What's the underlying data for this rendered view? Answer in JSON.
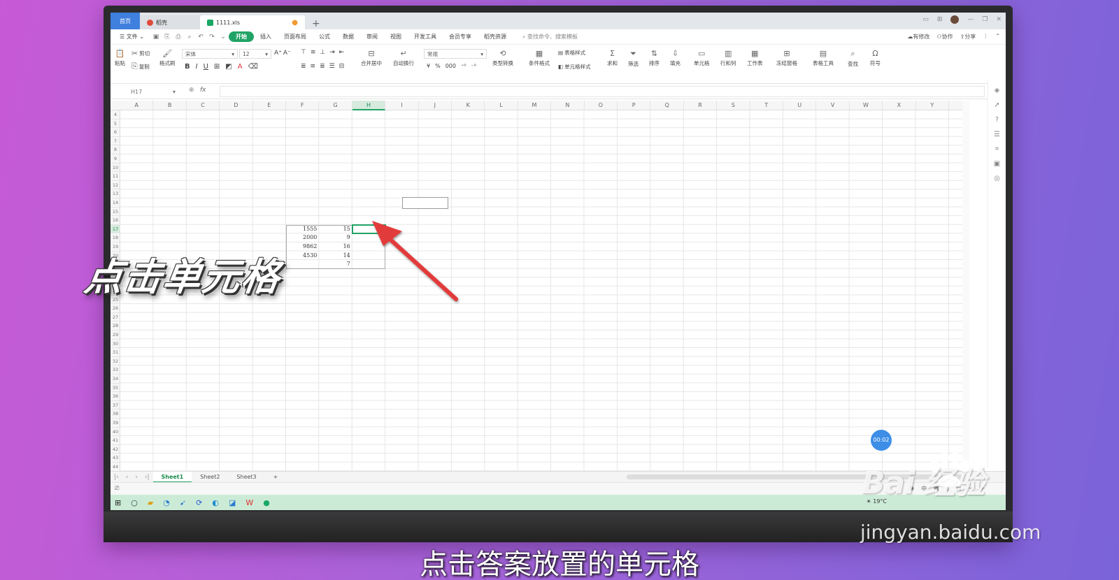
{
  "tabs": {
    "home": "首页",
    "shell": "稻壳",
    "file": "1111.xls",
    "modified_mark": "●",
    "add": "+"
  },
  "menu": {
    "file": "文件",
    "items": [
      "开始",
      "插入",
      "页面布局",
      "公式",
      "数据",
      "审阅",
      "视图",
      "开发工具",
      "会员专享",
      "稻壳资源"
    ],
    "active_index": 0,
    "search": "查找命令、搜索模板",
    "right": [
      "有修改",
      "协作",
      "分享"
    ]
  },
  "ribbon": {
    "clipboard": {
      "paste": "粘贴",
      "cut": "剪切",
      "copy": "复制",
      "format_painter": "格式刷"
    },
    "font": "宋体",
    "font_size": "12",
    "bold": "B",
    "italic": "I",
    "underline": "U",
    "merge": "合并居中",
    "wrap": "自动换行",
    "number_format": "常规",
    "currency": "¥",
    "percent": "%",
    "thousands": "000",
    "type_convert": "类型转换",
    "cond_format": "条件格式",
    "table_style": "表格样式",
    "cell_style": "单元格样式",
    "sum": "求和",
    "filter": "筛选",
    "sort": "排序",
    "fill": "填充",
    "cells": "单元格",
    "rows_cols": "行和列",
    "worksheet": "工作表",
    "freeze": "冻结窗格",
    "table_tools": "表格工具",
    "find": "查找",
    "symbol": "符号"
  },
  "formula_bar": {
    "name_box": "H17",
    "fx": "fx",
    "value": ""
  },
  "columns": [
    "A",
    "B",
    "C",
    "D",
    "E",
    "F",
    "G",
    "H",
    "I",
    "J",
    "K",
    "L",
    "M",
    "N",
    "O",
    "P",
    "Q",
    "R",
    "S",
    "T",
    "U",
    "V",
    "W",
    "X",
    "Y"
  ],
  "selected_column": "H",
  "rows": [
    "4",
    "5",
    "6",
    "7",
    "8",
    "9",
    "10",
    "11",
    "12",
    "13",
    "14",
    "15",
    "16",
    "17",
    "18",
    "19",
    "20",
    "21",
    "22",
    "23",
    "24",
    "25",
    "26",
    "27",
    "28",
    "29",
    "30",
    "31",
    "32",
    "33",
    "34",
    "35",
    "36",
    "37",
    "38",
    "39",
    "40",
    "41",
    "42",
    "43",
    "44",
    "45"
  ],
  "selected_row": "17",
  "cells": {
    "F17": "1555",
    "G17": "15",
    "F18": "2000",
    "G18": "9",
    "F19": "9862",
    "G19": "16",
    "F20": "4530",
    "G20": "14",
    "G21": "7"
  },
  "sheet_tabs": [
    "Sheet1",
    "Sheet2",
    "Sheet3"
  ],
  "active_sheet": "Sheet1",
  "timer": "00:02",
  "status": {
    "input": "中"
  },
  "taskbar": {
    "weather": "19°C"
  },
  "overlay": {
    "title": "点击单元格",
    "caption": "点击答案放置的单元格"
  },
  "watermark": {
    "brand": "Bai 经验",
    "url": "jingyan.baidu.com"
  },
  "colors": {
    "accent": "#21a366",
    "home_tab": "#3f7fde",
    "arrow": "#e23b3b",
    "timer": "#3d8ee6"
  }
}
